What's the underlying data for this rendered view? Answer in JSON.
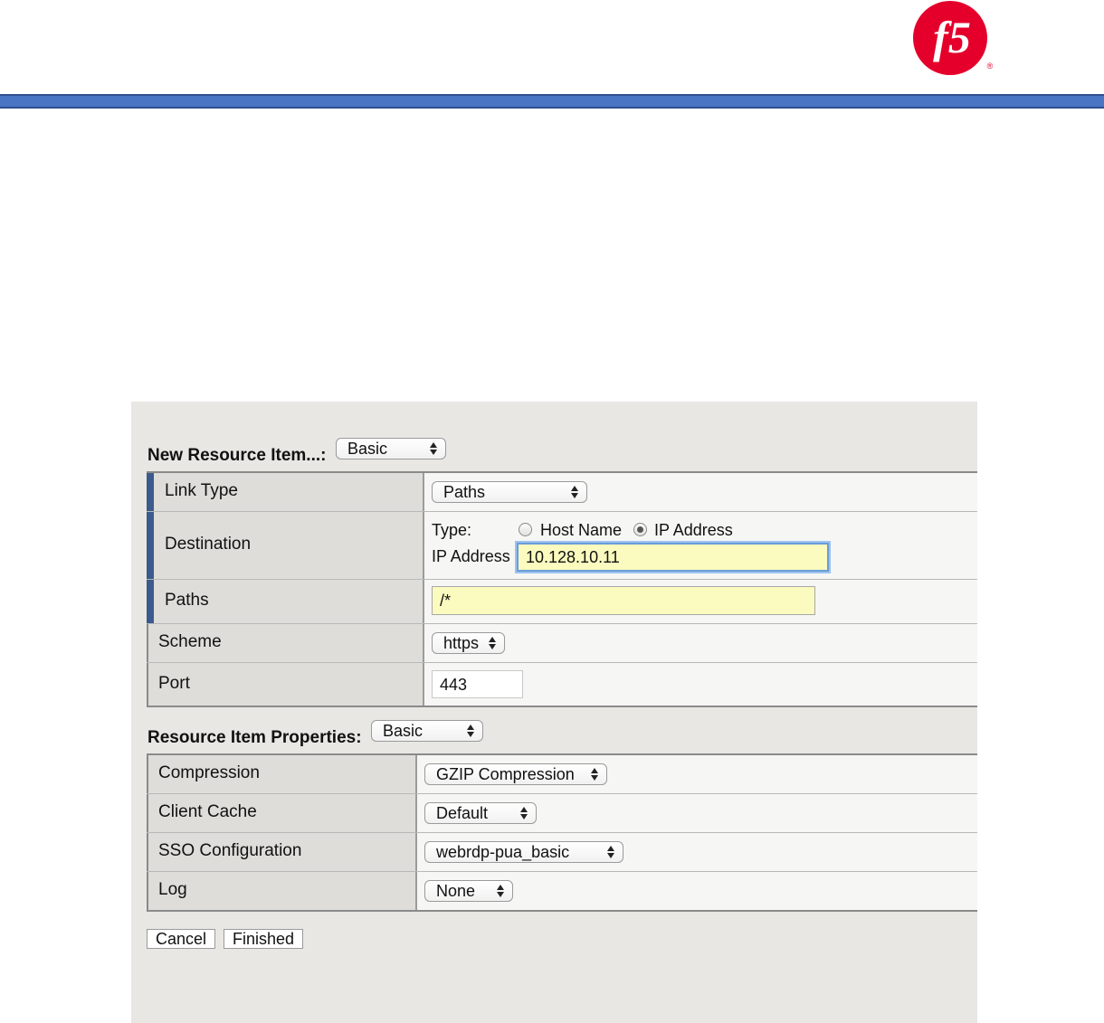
{
  "header": {
    "logo_text": "f5",
    "logo_mark": "®",
    "colors": {
      "logo_red": "#e4002b",
      "bar_blue": "#4a74c4"
    }
  },
  "resource_item": {
    "title": "New Resource Item...:",
    "mode": "Basic",
    "rows": {
      "link_type": {
        "label": "Link Type",
        "value": "Paths"
      },
      "destination": {
        "label": "Destination",
        "type_label": "Type:",
        "option_host": "Host Name",
        "option_ip": "IP Address",
        "selected": "IP Address",
        "ip_label": "IP Address",
        "ip_value": "10.128.10.11"
      },
      "paths": {
        "label": "Paths",
        "value": "/*"
      },
      "scheme": {
        "label": "Scheme",
        "value": "https"
      },
      "port": {
        "label": "Port",
        "value": "443"
      }
    }
  },
  "properties": {
    "title": "Resource Item Properties:",
    "mode": "Basic",
    "rows": {
      "compression": {
        "label": "Compression",
        "value": "GZIP Compression"
      },
      "client_cache": {
        "label": "Client Cache",
        "value": "Default"
      },
      "sso": {
        "label": "SSO Configuration",
        "value": "webrdp-pua_basic"
      },
      "log": {
        "label": "Log",
        "value": "None"
      }
    }
  },
  "buttons": {
    "cancel": "Cancel",
    "finished": "Finished"
  }
}
